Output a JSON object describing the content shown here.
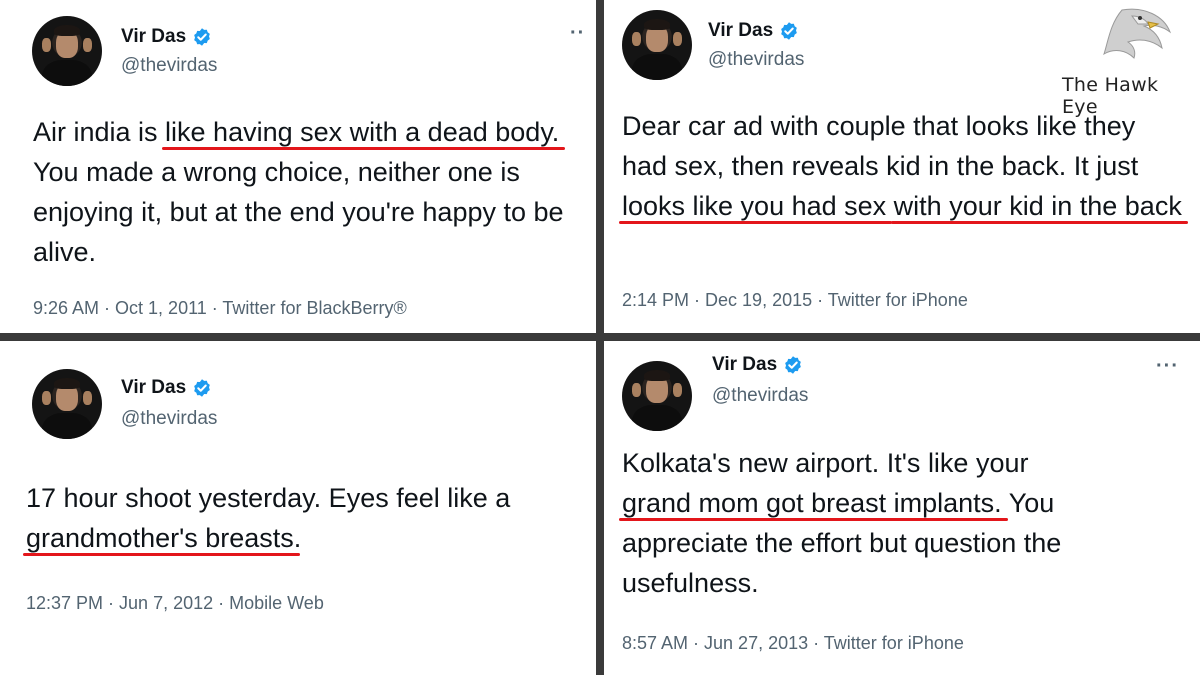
{
  "watermark": {
    "text": "The Hawk Eye",
    "icon": "eagle-icon"
  },
  "accent_underline_color": "#e3161b",
  "verified_color": "#1d9bf0",
  "tweets": [
    {
      "name": "Vir Das",
      "handle": "@thevirdas",
      "more": "··",
      "text_parts": [
        "Air india is ",
        "like having sex with a dead",
        " ",
        "body.",
        " You made a wrong choice, neither one is enjoying it, but at the end you're happy to be alive."
      ],
      "meta": "9:26 AM · Oct 1, 2011 · Twitter for BlackBerry®"
    },
    {
      "name": "Vir Das",
      "handle": "@thevirdas",
      "text_parts": [
        "Dear car ad with couple that looks like they had sex, then reveals kid in the back. It just ",
        "looks like you had sex",
        " ",
        "with your kid in the back"
      ],
      "meta": "2:14 PM · Dec 19, 2015 · Twitter for iPhone"
    },
    {
      "name": "Vir Das",
      "handle": "@thevirdas",
      "text_parts": [
        "17 hour shoot yesterday. Eyes feel like a ",
        "grandmother's breasts",
        "."
      ],
      "meta": "12:37 PM · Jun 7, 2012 · Mobile Web"
    },
    {
      "name": "Vir Das",
      "handle": "@thevirdas",
      "more": "···",
      "text_parts": [
        "Kolkata's new airport. It's like your ",
        "grand mom got breast implants.",
        " You appreciate the effort but question the usefulness."
      ],
      "meta": "8:57 AM · Jun 27, 2013 · Twitter for iPhone"
    }
  ]
}
